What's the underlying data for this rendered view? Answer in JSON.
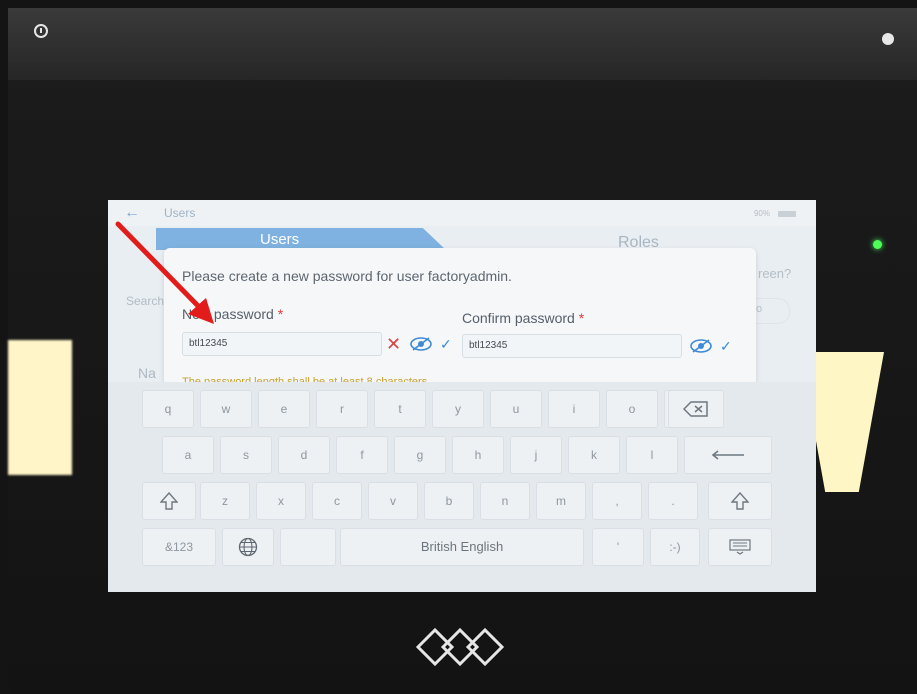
{
  "topbar": {
    "title": "Users",
    "battery_text": "90%"
  },
  "tabs": {
    "users": "Users",
    "roles": "Roles"
  },
  "background": {
    "search": "Search",
    "name": "Na",
    "question": "reen?",
    "pill": "o"
  },
  "dialog": {
    "message": "Please create a new password for user factoryadmin.",
    "new_password": {
      "label": "New password",
      "value": "btl12345"
    },
    "confirm_password": {
      "label": "Confirm password",
      "value": "btl12345"
    },
    "required_mark": "*",
    "hint": "The password length shall be at least 8 characters"
  },
  "keyboard": {
    "row1": [
      "q",
      "w",
      "e",
      "r",
      "t",
      "y",
      "u",
      "i",
      "o",
      "p"
    ],
    "row2": [
      "a",
      "s",
      "d",
      "f",
      "g",
      "h",
      "j",
      "k",
      "l"
    ],
    "row3": [
      "z",
      "x",
      "c",
      "v",
      "b",
      "n",
      "m",
      ",",
      "."
    ],
    "row4": {
      "symbols": "&123",
      "space": "British English",
      "apostrophe": "'",
      "emoji": ":-)"
    },
    "icons": {
      "backspace": "backspace-icon",
      "enter": "enter-icon",
      "shift": "shift-icon",
      "globe": "globe-icon",
      "hide": "keyboard-hide-icon"
    }
  },
  "colors": {
    "accent": "#7fb2e0",
    "error": "#d94444",
    "required": "#e03b3b",
    "check": "#3f8ad6",
    "annotation_arrow": "#e21b1b"
  }
}
